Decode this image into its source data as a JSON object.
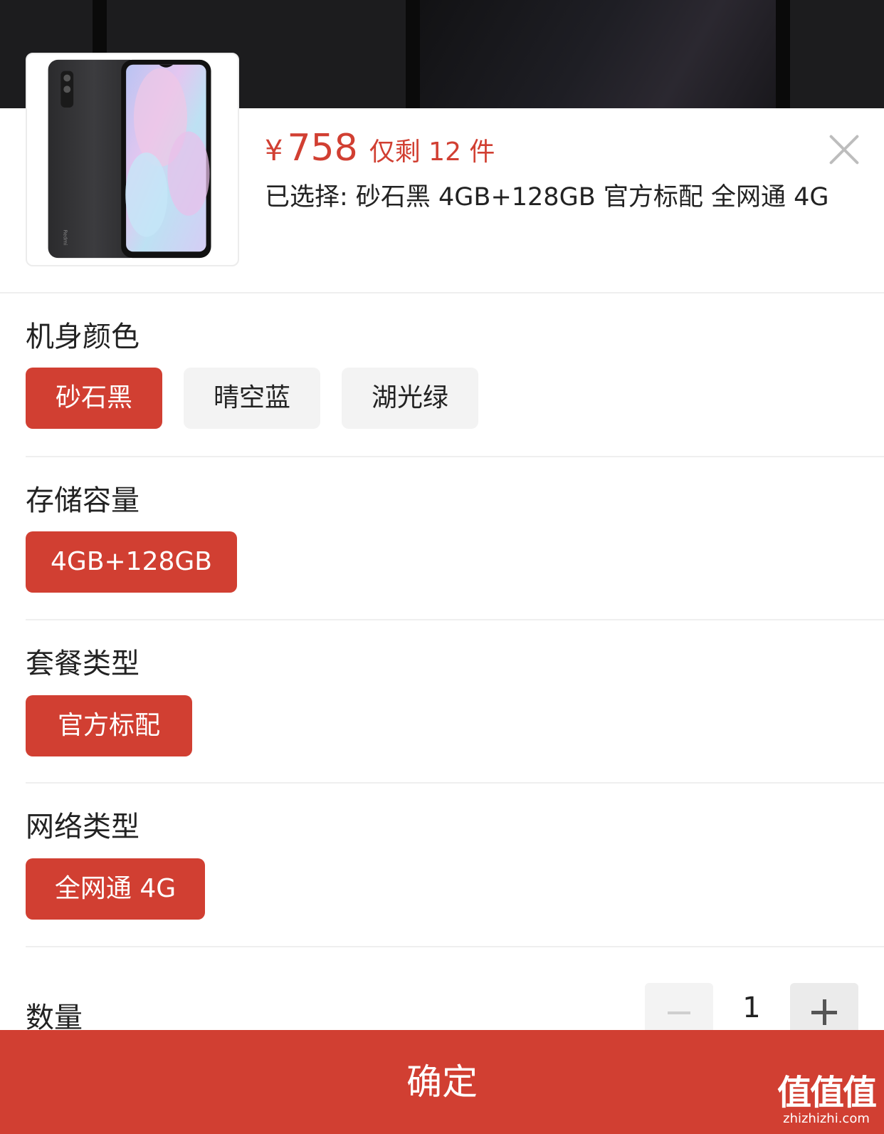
{
  "product": {
    "price_symbol": "¥",
    "price": "758",
    "stock_text": "仅剩 12 件",
    "selected_text": "已选择: 砂石黑 4GB+128GB 官方标配 全网通 4G",
    "thumbnail_brand": "Redmi"
  },
  "sections": {
    "color": {
      "title": "机身颜色",
      "options": [
        "砂石黑",
        "晴空蓝",
        "湖光绿"
      ]
    },
    "storage": {
      "title": "存储容量",
      "options": [
        "4GB+128GB"
      ]
    },
    "package": {
      "title": "套餐类型",
      "options": [
        "官方标配"
      ]
    },
    "network": {
      "title": "网络类型",
      "options": [
        "全网通 4G"
      ]
    }
  },
  "quantity": {
    "label": "数量",
    "value": "1"
  },
  "confirm_label": "确定",
  "watermark": {
    "logo": "值值值",
    "url": "zhizhizhi.com"
  },
  "colors": {
    "accent": "#d13f32",
    "chip_inactive": "#f3f3f3",
    "backdrop": "#1c1c1e"
  },
  "icons": [
    "close-icon",
    "minus-icon",
    "plus-icon"
  ]
}
